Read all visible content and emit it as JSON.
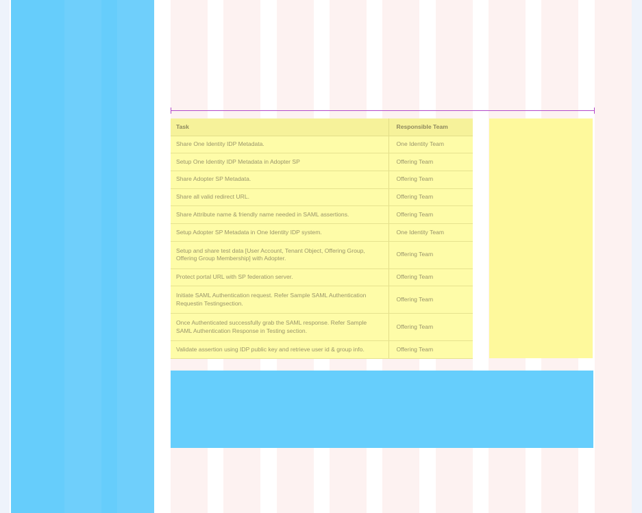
{
  "table": {
    "headers": {
      "task": "Task",
      "team": "Responsible Team"
    },
    "rows": [
      {
        "task": "Share One Identity IDP Metadata.",
        "team": "One Identity Team"
      },
      {
        "task": "Setup One Identity IDP Metadata in Adopter SP",
        "team": "Offering Team"
      },
      {
        "task": "Share Adopter SP Metadata.",
        "team": "Offering Team"
      },
      {
        "task": "Share all valid redirect URL.",
        "team": "Offering Team"
      },
      {
        "task": "Share Attribute name & friendly name needed in SAML assertions.",
        "team": "Offering Team"
      },
      {
        "task": "Setup Adopter SP Metadata in One Identity IDP system.",
        "team": "One Identity Team"
      },
      {
        "task": "Setup and share test data [User Account, Tenant Object, Offering Group, Offering Group Membership] with Adopter.",
        "team": "Offering Team"
      },
      {
        "task": "Protect portal URL with SP federation server.",
        "team": "Offering Team"
      },
      {
        "task": "Initiate SAML Authentication request. Refer Sample SAML Authentication Requestin Testingsection.",
        "team": "Offering Team"
      },
      {
        "task": "Once Authenticated successfully grab the SAML response. Refer Sample SAML Authentication Response in Testing section.",
        "team": "Offering Team"
      },
      {
        "task": "Validate assertion using IDP public key and retrieve user id & group info.",
        "team": "Offering Team"
      }
    ]
  },
  "colors": {
    "background": "#eef3fb",
    "sidebar": "#66cdfb",
    "table_header": "#f6f29a",
    "table_body": "#fefca8",
    "guide_column": "#fdf2f1",
    "measure_line": "#b248c9"
  }
}
